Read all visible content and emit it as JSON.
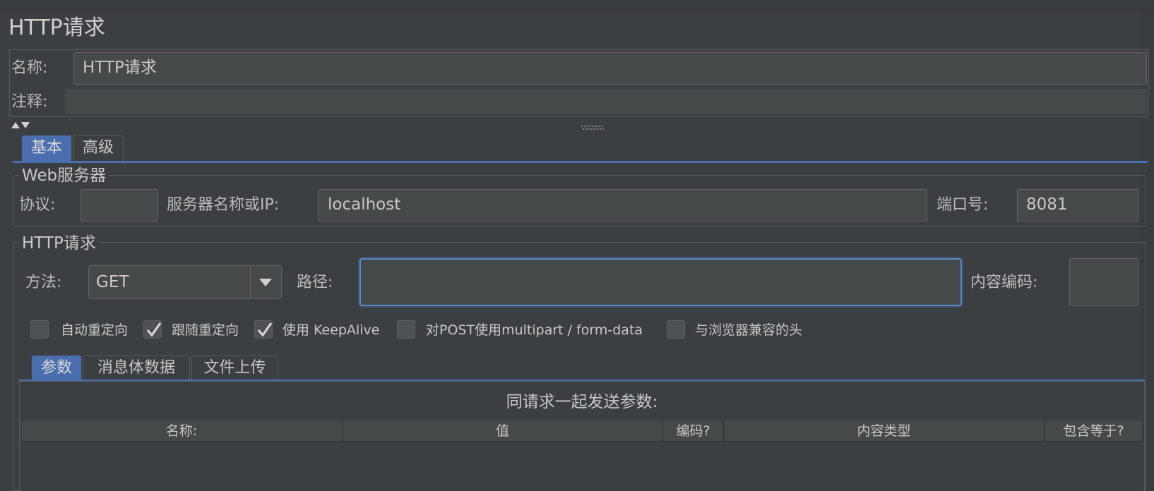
{
  "window": {
    "title": "HTTP请求"
  },
  "general": {
    "name_label": "名称:",
    "name_value": "HTTP请求",
    "comment_label": "注释:",
    "comment_value": ""
  },
  "main_tabs": [
    {
      "label": "基本",
      "active": true
    },
    {
      "label": "高级",
      "active": false
    }
  ],
  "web_server": {
    "title": "Web服务器",
    "protocol_label": "协议:",
    "protocol_value": "",
    "server_label": "服务器名称或IP:",
    "server_value": "localhost",
    "port_label": "端口号:",
    "port_value": "8081"
  },
  "http_request": {
    "title": "HTTP请求",
    "method_label": "方法:",
    "method_value": "GET",
    "path_label": "路径:",
    "path_value": "",
    "encoding_label": "内容编码:",
    "encoding_value": ""
  },
  "options": [
    {
      "label": "自动重定向",
      "checked": false
    },
    {
      "label": "跟随重定向",
      "checked": true
    },
    {
      "label": "使用 KeepAlive",
      "checked": true
    },
    {
      "label": "对POST使用multipart / form-data",
      "checked": false
    },
    {
      "label": "与浏览器兼容的头",
      "checked": false
    }
  ],
  "param_tabs": [
    {
      "label": "参数",
      "active": true
    },
    {
      "label": "消息体数据",
      "active": false
    },
    {
      "label": "文件上传",
      "active": false
    }
  ],
  "params_table": {
    "caption": "同请求一起发送参数:",
    "columns": [
      "名称:",
      "值",
      "编码?",
      "内容类型",
      "包含等于?"
    ]
  },
  "colors": {
    "background": "#3c3f41",
    "field": "#45494a",
    "accent": "#4b6eaf",
    "focus_border": "#5a89c4",
    "text": "#bbbbbb"
  },
  "icons": {
    "collapse": "triangle-up-down-icon",
    "splitter": "grip-dots-icon",
    "dropdown": "chevron-down-icon",
    "check": "checkmark-icon"
  }
}
